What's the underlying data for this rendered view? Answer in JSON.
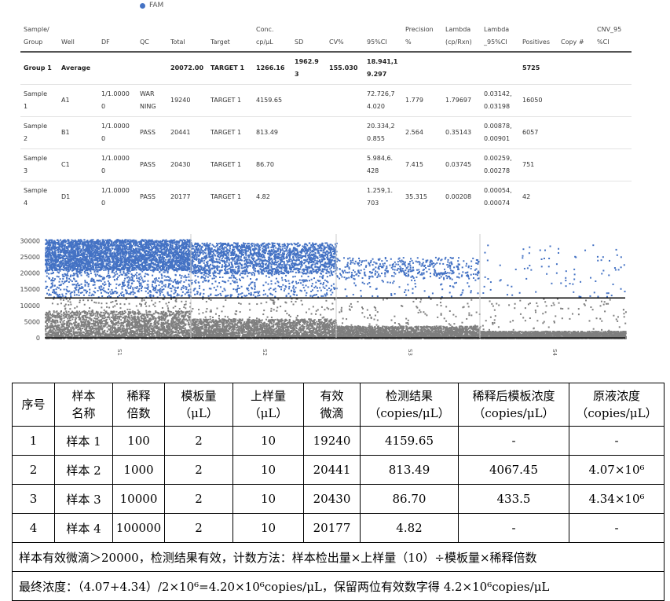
{
  "legend": {
    "label": "FAM",
    "color": "#4472c4"
  },
  "top_table": {
    "headers": [
      "Sample/\nGroup",
      "Well",
      "DF",
      "QC",
      "Total",
      "Target",
      "Conc.\ncp/μL",
      "SD",
      "CV%",
      "95%CI",
      "Precision\n%",
      "Lambda\n(cp/Rxn)",
      "Lambda\n_95%CI",
      "Positives",
      "Copy #",
      "CNV_95\n%CI"
    ],
    "average_row": [
      "Group 1",
      "Average",
      "",
      "",
      "20072.00",
      "TARGET 1",
      "1266.16",
      "1962.9\n3",
      "155.030",
      "18.941,1\n9.297",
      "",
      "",
      "",
      "5725",
      "",
      ""
    ],
    "rows": [
      [
        "Sample\n1",
        "A1",
        "1/1.0000\n0",
        "WAR\nNING",
        "19240",
        "TARGET 1",
        "4159.65",
        "",
        "",
        "72.726,7\n4.020",
        "1.779",
        "1.79697",
        "0.03142,\n0.03198",
        "16050",
        "",
        ""
      ],
      [
        "Sample\n2",
        "B1",
        "1/1.0000\n0",
        "PASS",
        "20441",
        "TARGET 1",
        "813.49",
        "",
        "",
        "20.334,2\n0.855",
        "2.564",
        "0.35143",
        "0.00878,\n0.00901",
        "6057",
        "",
        ""
      ],
      [
        "Sample\n3",
        "C1",
        "1/1.0000\n0",
        "PASS",
        "20430",
        "TARGET 1",
        "86.70",
        "",
        "",
        "5.984,6.\n428",
        "7.415",
        "0.03745",
        "0.00259,\n0.00278",
        "751",
        "",
        ""
      ],
      [
        "Sample\n4",
        "D1",
        "1/1.0000\n0",
        "PASS",
        "20177",
        "TARGET 1",
        "4.82",
        "",
        "",
        "1.259,1.\n703",
        "35.315",
        "0.00208",
        "0.00054,\n0.00074",
        "42",
        "",
        ""
      ]
    ]
  },
  "scatter": {
    "y_ticks": [
      "30000",
      "25000",
      "20000",
      "15000",
      "10000",
      "5000",
      "0"
    ],
    "x_labels": [
      "S1",
      "S2",
      "S3",
      "S4"
    ],
    "threshold": 12300,
    "positive_color": "#4472c4",
    "negative_color": "#7f7f7f",
    "ylim": [
      0,
      32000
    ]
  },
  "cn_table": {
    "headers": [
      "序号",
      "样本\n名称",
      "稀释\n倍数",
      "模板量\n（μL）",
      "上样量\n（μL）",
      "有效\n微滴",
      "检测结果\n（copies/μL）",
      "稀释后模板浓度\n（copies/μL）",
      "原液浓度\n（copies/μL）"
    ],
    "rows": [
      [
        "1",
        "样本 1",
        "100",
        "2",
        "10",
        "19240",
        "4159.65",
        "-",
        "-"
      ],
      [
        "2",
        "样本 2",
        "1000",
        "2",
        "10",
        "20441",
        "813.49",
        "4067.45",
        "4.07×10⁶"
      ],
      [
        "3",
        "样本 3",
        "10000",
        "2",
        "10",
        "20430",
        "86.70",
        "433.5",
        "4.34×10⁶"
      ],
      [
        "4",
        "样本 4",
        "100000",
        "2",
        "10",
        "20177",
        "4.82",
        "-",
        "-"
      ]
    ],
    "note1": "样本有效微滴＞20000，检测结果有效，计数方法：样本检出量×上样量（10）÷模板量×稀释倍数",
    "note2": "最终浓度：（4.07+4.34）/2×10⁶=4.20×10⁶copies/μL，保留两位有效数字得 4.2×10⁶copies/μL"
  }
}
